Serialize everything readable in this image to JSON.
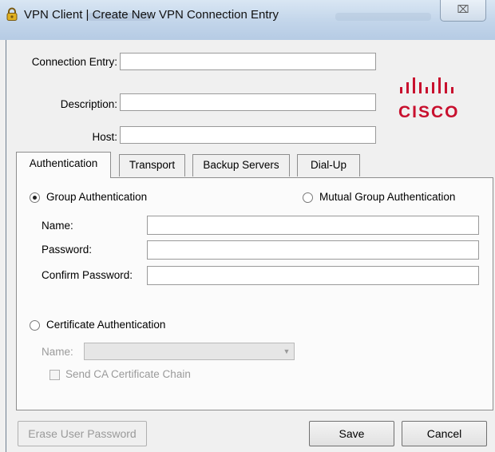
{
  "window": {
    "title": "VPN Client  |  Create New VPN Connection Entry",
    "close_glyph": "⌧"
  },
  "form": {
    "connection_entry_label": "Connection Entry:",
    "connection_entry_value": "",
    "description_label": "Description:",
    "description_value": "",
    "host_label": "Host:",
    "host_value": ""
  },
  "logo": {
    "text": "CISCO",
    "color": "#c8102e",
    "icon": "cisco-bridge-logo"
  },
  "tabs": [
    {
      "label": "Authentication",
      "active": true
    },
    {
      "label": "Transport",
      "active": false
    },
    {
      "label": "Backup Servers",
      "active": false
    },
    {
      "label": "Dial-Up",
      "active": false
    }
  ],
  "auth": {
    "group_auth_label": "Group Authentication",
    "group_auth_selected": true,
    "mutual_auth_label": "Mutual Group Authentication",
    "mutual_auth_selected": false,
    "name_label": "Name:",
    "name_value": "",
    "password_label": "Password:",
    "password_value": "",
    "confirm_label": "Confirm Password:",
    "confirm_value": "",
    "cert_auth_label": "Certificate Authentication",
    "cert_auth_selected": false,
    "cert_name_label": "Name:",
    "cert_name_value": "",
    "send_chain_label": "Send CA Certificate Chain",
    "send_chain_checked": false
  },
  "buttons": {
    "erase_label": "Erase User Password",
    "save_label": "Save",
    "cancel_label": "Cancel"
  }
}
